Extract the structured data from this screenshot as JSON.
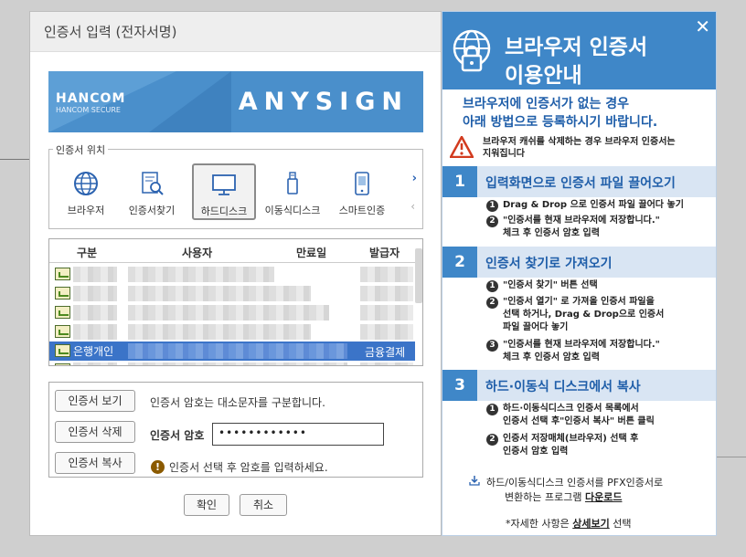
{
  "dialog": {
    "title": "인증서 입력 (전자서명)",
    "brand": "HANCOM",
    "brand_sub": "HANCOM SECURE",
    "product": "ANYSIGN",
    "location_label": "인증서 위치",
    "locations": [
      {
        "label": "브라우저",
        "icon": "globe-icon"
      },
      {
        "label": "인증서찾기",
        "icon": "certificate-search-icon"
      },
      {
        "label": "하드디스크",
        "icon": "monitor-icon"
      },
      {
        "label": "이동식디스크",
        "icon": "usb-icon"
      },
      {
        "label": "스마트인증",
        "icon": "smartphone-icon"
      }
    ],
    "selected_location": "하드디스크",
    "table": {
      "headers": [
        "구분",
        "사용자",
        "만료일",
        "발급자"
      ],
      "selected_row": {
        "type": "은행개인",
        "issuer": "금융결제원"
      }
    },
    "buttons": {
      "view": "인증서 보기",
      "delete": "인증서 삭제",
      "copy": "인증서 복사",
      "ok": "확인",
      "cancel": "취소"
    },
    "case_hint": "인증서 암호는 대소문자를 구분합니다.",
    "password_label": "인증서 암호",
    "password_value": "••••••••••••",
    "password_hint": "인증서 선택 후 암호를 입력하세요."
  },
  "panel": {
    "title_line1": "브라우저 인증서",
    "title_line2": "이용안내",
    "intro_line1": "브라우저에 인증서가 없는 경우",
    "intro_line2": "아래 방법으로 등록하시기 바랍니다.",
    "caution_line1": "브라우저 캐쉬를 삭제하는 경우 브라우저 인증서는",
    "caution_line2": "지워집니다",
    "steps": [
      {
        "num": "1",
        "title": "입력화면으로 인증서 파일 끌어오기",
        "items": [
          {
            "n": "1",
            "lines": [
              "Drag & Drop 으로 인증서 파일 끌어다 놓기"
            ]
          },
          {
            "n": "2",
            "lines": [
              "\"인증서를 현재 브라우저에 저장합니다.\"",
              "체크 후 인증서 암호 입력"
            ]
          }
        ]
      },
      {
        "num": "2",
        "title": "인증서 찾기로 가져오기",
        "items": [
          {
            "n": "1",
            "lines": [
              "\"인증서 찾기\" 버튼 선택"
            ]
          },
          {
            "n": "2",
            "lines": [
              "\"인증서 열기\" 로 가져올 인증서 파일을",
              "선택 하거나, Drag & Drop으로 인증서",
              "파일 끌어다 놓기"
            ]
          },
          {
            "n": "3",
            "lines": [
              "\"인증서를 현재 브라우저에 저장합니다.\"",
              "체크 후 인증서 암호 입력"
            ]
          }
        ]
      },
      {
        "num": "3",
        "title": "하드·이동식 디스크에서 복사",
        "items": [
          {
            "n": "1",
            "lines": [
              "하드·이동식디스크 인증서 목록에서",
              "인증서 선택 후\"인증서 복사\" 버튼 클릭"
            ]
          },
          {
            "n": "2",
            "lines": [
              "인증서 저장매체(브라우저) 선택 후",
              "인증서 암호 입력"
            ]
          }
        ]
      }
    ],
    "download_line1": "하드/이동식디스크 인증서를 PFX인증서로",
    "download_line2_prefix": "변환하는 프로그램 ",
    "download_link": "다운로드",
    "detail_prefix": "*자세한 사항은 ",
    "detail_link": "상세보기",
    "detail_suffix": " 선택"
  }
}
